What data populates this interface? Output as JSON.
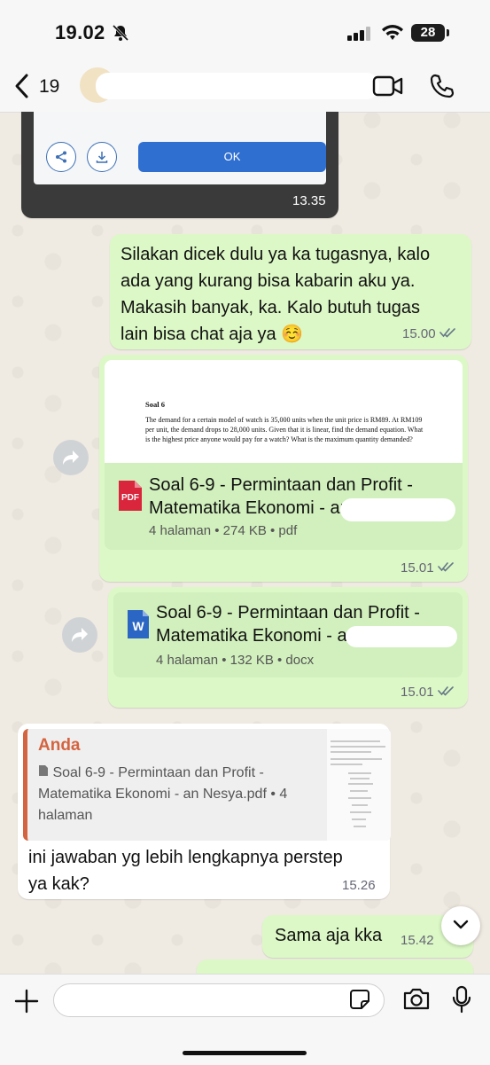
{
  "status": {
    "time": "19.02",
    "battery": "28"
  },
  "header": {
    "back_count": "19",
    "contact_name": ""
  },
  "messages": {
    "image_msg": {
      "ok_label": "OK",
      "time": "13.35"
    },
    "text_msg": {
      "lines": [
        "Silakan dicek dulu ya ka tugasnya, kalo",
        "ada yang kurang bisa kabarin aku ya.",
        "Makasih banyak, ka. Kalo butuh tugas",
        "lain bisa chat aja ya ☺️"
      ],
      "time": "15.00"
    },
    "pdf_msg": {
      "preview_title": "Soal 6",
      "preview_text": "The demand for a certain model of watch is 35,000 units when the unit price is RM89. At RM109 per unit, the demand drops to 28,000 units. Given that it is linear, find the demand equation. What is the highest price anyone would pay for a watch? What is the maximum quantity demanded?",
      "file_line1": "Soal 6-9 - Permintaan dan Profit -",
      "file_line2": "Matematika Ekonomi - an N",
      "file_meta": "4 halaman • 274 KB • pdf",
      "icon_label": "PDF",
      "time": "15.01"
    },
    "docx_msg": {
      "file_line1": "Soal 6-9 - Permintaan dan Profit -",
      "file_line2": "Matematika Ekonomi - an N",
      "file_meta": "4 halaman • 132 KB • docx",
      "icon_label": "W",
      "time": "15.01"
    },
    "reply_msg": {
      "quote_name": "Anda",
      "quote_text": "Soal 6-9 - Permintaan dan Profit - Matematika Ekonomi - an Nesya.pdf • 4 halaman",
      "line1": "ini jawaban yg lebih lengkapnya perstep",
      "line2": "ya kak?",
      "time": "15.26"
    },
    "short_msg": {
      "text": "Sama aja kka",
      "time": "15.42"
    }
  },
  "colors": {
    "outgoing_bubble": "#dcf8c6",
    "file_panel": "#d1f0bd",
    "quote_accent": "#d4643f",
    "pdf_red": "#d9263c",
    "word_blue": "#2b66c4",
    "ticks": "#667788"
  }
}
